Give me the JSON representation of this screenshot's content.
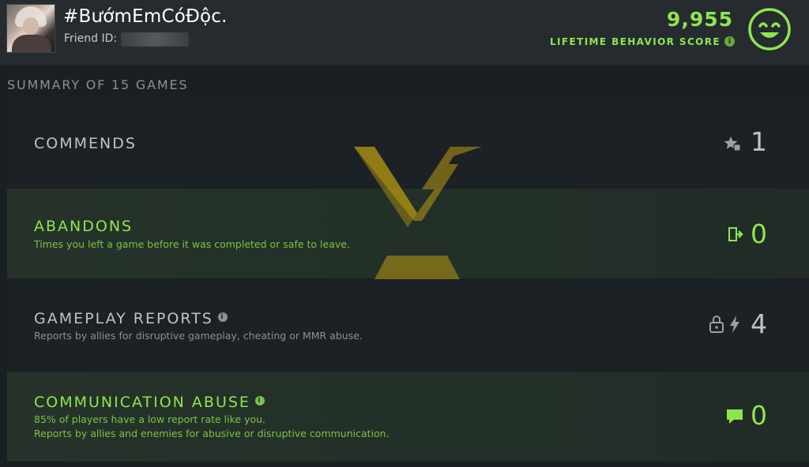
{
  "header": {
    "player_name": "#BướmEmCóĐộc.",
    "friend_id_label": "Friend ID:",
    "score_value": "9,955",
    "score_label": "LIFETIME BEHAVIOR SCORE",
    "score_info_glyph": "i",
    "score_face_icon": "smile-face-icon",
    "accent_color": "#8ee64d"
  },
  "summary": {
    "title": "SUMMARY OF 15 GAMES",
    "rows": [
      {
        "title": "COMMENDS",
        "description": "",
        "count": "1",
        "icon": "star-thumb-icon"
      },
      {
        "title": "ABANDONS",
        "description": "Times you left a game before it was completed or safe to leave.",
        "count": "0",
        "icon": "exit-door-icon"
      },
      {
        "title": "GAMEPLAY REPORTS",
        "description": "Reports by allies for disruptive gameplay, cheating or MMR abuse.",
        "count": "4",
        "icon": "lock-lightning-icon",
        "info_glyph": "i"
      },
      {
        "title": "COMMUNICATION ABUSE",
        "description_line1": "85% of players have a low report rate like you.",
        "description_line2": "Reports by allies and enemies for abusive or disruptive communication.",
        "count": "0",
        "icon": "chat-bubble-icon",
        "info_glyph": "i"
      }
    ]
  },
  "watermark_icon": "dota-plus-emblem-icon"
}
